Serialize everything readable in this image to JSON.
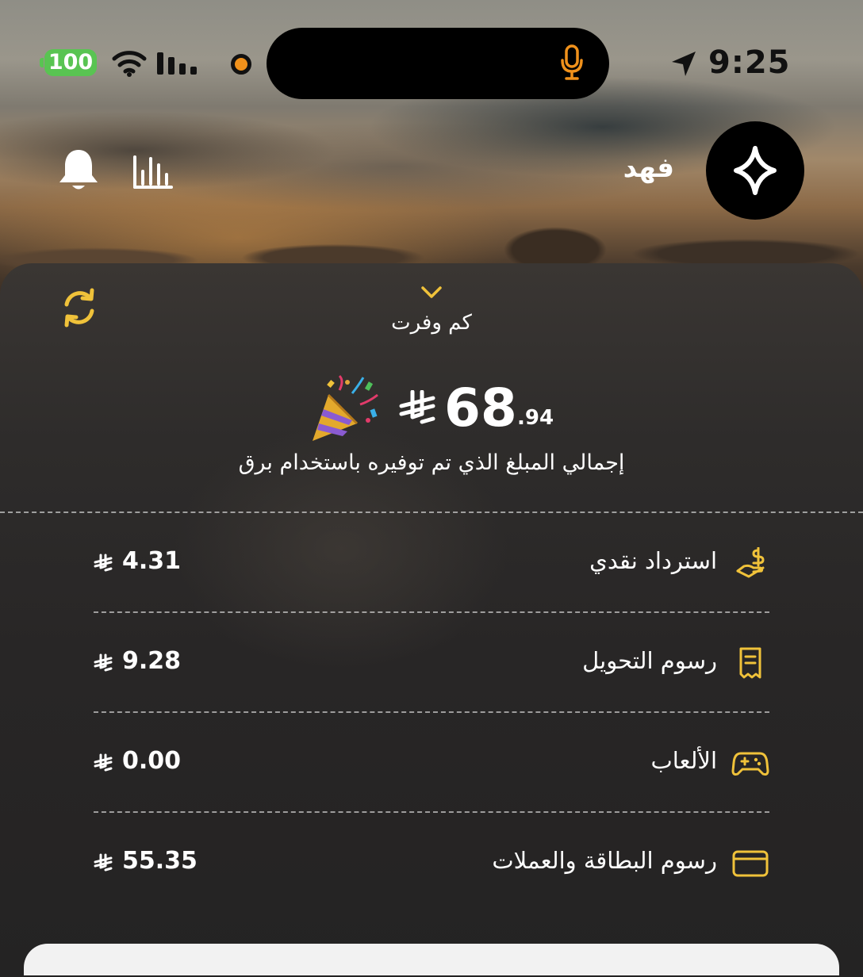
{
  "status_bar": {
    "time": "9:25",
    "battery": "100"
  },
  "header": {
    "username": "فهد"
  },
  "savings": {
    "title": "كم وفرت",
    "amount_main": "68",
    "amount_cents": ".94",
    "subtitle": "إجمالي المبلغ الذي تم توفيره باستخدام برق",
    "items": [
      {
        "label": "استرداد نقدي",
        "value": "4.31",
        "icon": "cashback-hand-icon"
      },
      {
        "label": "رسوم التحويل",
        "value": "9.28",
        "icon": "receipt-icon"
      },
      {
        "label": "الألعاب",
        "value": "0.00",
        "icon": "gamepad-icon"
      },
      {
        "label": "رسوم البطاقة والعملات",
        "value": "55.35",
        "icon": "card-icon"
      }
    ]
  },
  "colors": {
    "accent": "#f0c23a",
    "battery": "#59c452",
    "mic": "#f0911b"
  }
}
